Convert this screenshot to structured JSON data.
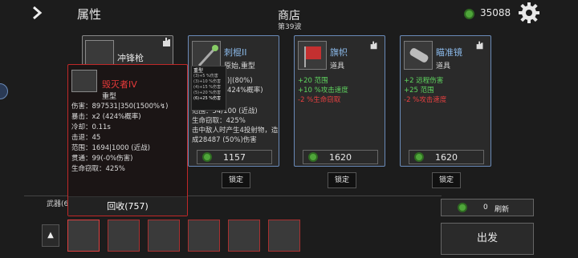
{
  "header": {
    "section": "属性",
    "shop_title": "商店",
    "wave": "第39波",
    "money": "35088"
  },
  "cards": [
    {
      "name": "冲锋枪",
      "type": ""
    },
    {
      "name": "刺棍II",
      "type_partial": "原始,重型",
      "stats": [
        {
          "text": ")|(80%)",
          "cls": "w"
        },
        {
          "text": "424%概率)",
          "cls": "w"
        },
        {
          "text": "范围：54/100 (近战)",
          "cls": "w"
        },
        {
          "text": "生命窃取：425%",
          "cls": "w"
        },
        {
          "text": "击中敌人时产生4投射物，造",
          "cls": "w"
        },
        {
          "text": "成28487 (50%)伤害",
          "cls": "w"
        }
      ],
      "price": "1157",
      "lock": "锁定"
    },
    {
      "name": "旗帜",
      "type": "道具",
      "stats": [
        {
          "text": "+20 范围",
          "cls": "g"
        },
        {
          "text": "+10 %攻击速度",
          "cls": "g"
        },
        {
          "text": "-2 %生命窃取",
          "cls": "r"
        }
      ],
      "price": "1620",
      "lock": "锁定"
    },
    {
      "name": "瞄准镜",
      "type": "道具",
      "stats": [
        {
          "text": "+2 远程伤害",
          "cls": "g"
        },
        {
          "text": "+25 范围",
          "cls": "g"
        },
        {
          "text": "-2 %攻击速度",
          "cls": "r"
        }
      ],
      "price": "1620",
      "lock": "锁定"
    }
  ],
  "popup": {
    "name": "毁灭者IV",
    "type": "重型",
    "stats": [
      "伤害：897531|350(1500%↯)",
      "暴击：x2 (424%概率)",
      "冷却：0.11s",
      "击退：45",
      "范围：1694|1000 (近战)",
      "贯通：99(-0%伤害)",
      "生命窃取：425%"
    ],
    "recycle": "回收(757)"
  },
  "mini_tooltip": {
    "title": "重型",
    "lines": [
      "(3)+5 %伤害",
      "(3)+10 %伤害",
      "(4)+15 %伤害",
      "(5)+20 %伤害",
      "(6)+25 %伤害"
    ]
  },
  "weapons_label": "武器(6",
  "refresh": {
    "count": "0",
    "label": "刷新"
  },
  "start": "出发",
  "colors": {
    "accent_blue": "#6a8ab8",
    "danger_red": "#c02828",
    "coin_green": "#4fa63a"
  }
}
